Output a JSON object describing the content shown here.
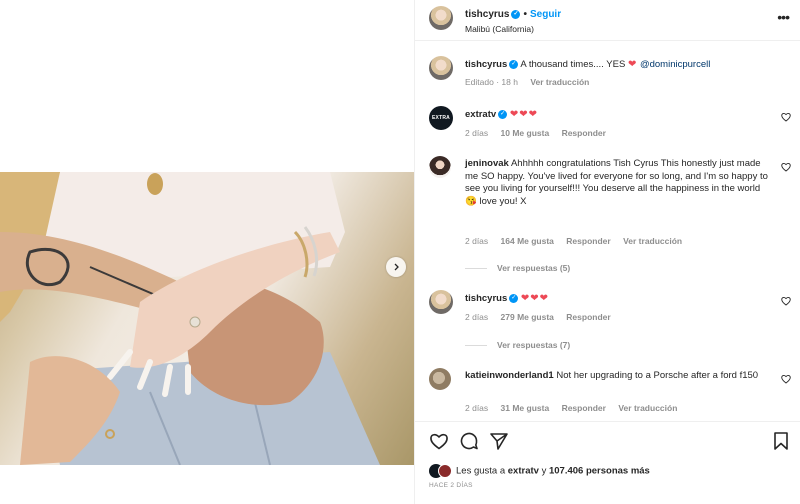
{
  "header": {
    "username": "tishcyrus",
    "dot": "•",
    "follow_label": "Seguir",
    "location": "Malibú (California)",
    "more_label": "•••"
  },
  "caption": {
    "username": "tishcyrus",
    "text": "A thousand times.... YES",
    "heart": "❤",
    "mention": "@dominicpurcell",
    "edited": "Editado · 18 h",
    "translate": "Ver traducción"
  },
  "comments": [
    {
      "username": "extratv",
      "avatar_text": "EXTRA",
      "text": "❤❤❤",
      "time": "2 días",
      "likes": "10 Me gusta",
      "reply": "Responder"
    },
    {
      "username": "jeninovak",
      "text": "Ahhhhh congratulations Tish Cyrus This honestly just made me SO happy. You've lived for everyone for so long, and I'm so happy to see you living for yourself!!! You deserve all the happiness in the world😘 love you! X",
      "time": "2 días",
      "likes": "164 Me gusta",
      "reply": "Responder",
      "translate": "Ver traducción",
      "view_replies": "Ver respuestas (5)"
    },
    {
      "username": "tishcyrus",
      "text": "❤❤❤",
      "time": "2 días",
      "likes": "279 Me gusta",
      "reply": "Responder",
      "view_replies": "Ver respuestas (7)"
    },
    {
      "username": "katieinwonderland1",
      "text": "Not her upgrading to a Porsche after a ford f150",
      "time": "2 días",
      "likes": "31 Me gusta",
      "reply": "Responder",
      "translate": "Ver traducción"
    }
  ],
  "likes_line": {
    "prefix": "Les gusta a",
    "user": "extratv",
    "conj": "y",
    "count": "107.406 personas más"
  },
  "post_date": "HACE 2 DÍAS",
  "icons": [
    "heart-icon",
    "comment-icon",
    "share-icon",
    "bookmark-icon",
    "more-icon",
    "chevron-right-icon",
    "verified-icon"
  ],
  "colors": {
    "link": "#0095f6",
    "heart": "#ed4956",
    "muted": "#8e8e8e",
    "mention": "#00376b"
  }
}
